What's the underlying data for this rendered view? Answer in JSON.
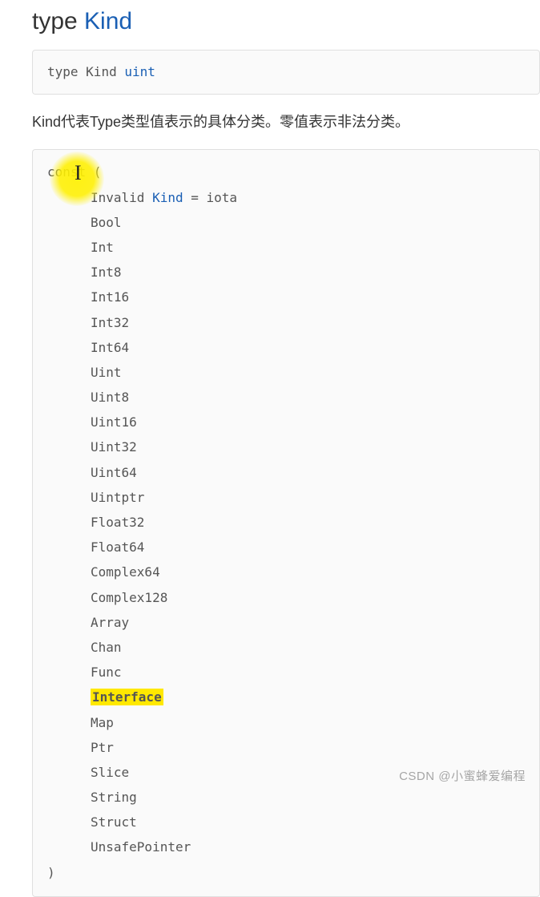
{
  "heading": {
    "prefix": "type ",
    "name": "Kind"
  },
  "typedef": {
    "kw": "type",
    "name": "Kind",
    "base": "uint"
  },
  "description": "Kind代表Type类型值表示的具体分类。零值表示非法分类。",
  "const_block": {
    "open": "const (",
    "first_line": {
      "name": "Invalid",
      "type": "Kind",
      "eq": "=",
      "val": "iota"
    },
    "items": [
      "Bool",
      "Int",
      "Int8",
      "Int16",
      "Int32",
      "Int64",
      "Uint",
      "Uint8",
      "Uint16",
      "Uint32",
      "Uint64",
      "Uintptr",
      "Float32",
      "Float64",
      "Complex64",
      "Complex128",
      "Array",
      "Chan",
      "Func",
      "Interface",
      "Map",
      "Ptr",
      "Slice",
      "String",
      "Struct",
      "UnsafePointer"
    ],
    "highlighted_item": "Interface",
    "close": ")"
  },
  "watermark": "CSDN @小蜜蜂爱编程"
}
